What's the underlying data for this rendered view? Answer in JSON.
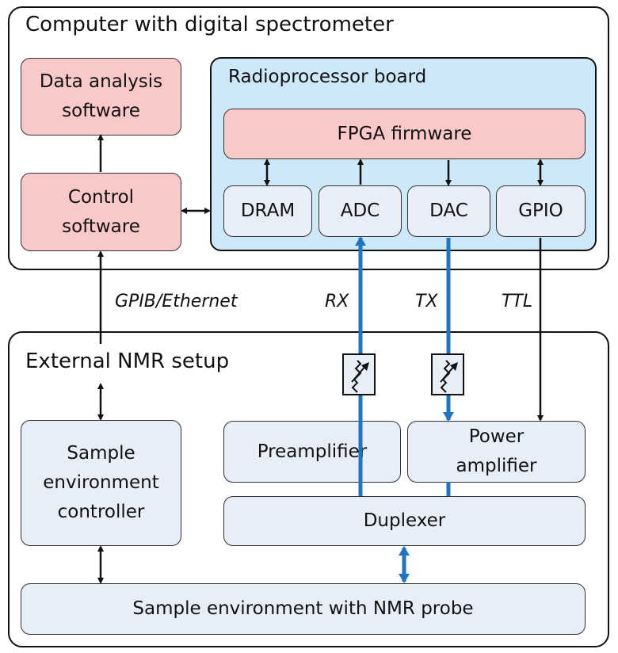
{
  "computer": {
    "title": "Computer with digital spectrometer",
    "data_analysis": "Data analysis software",
    "control": "Control software",
    "board": {
      "title": "Radioprocessor board",
      "fpga": "FPGA firmware",
      "dram": "DRAM",
      "adc": "ADC",
      "dac": "DAC",
      "gpio": "GPIO"
    }
  },
  "links": {
    "gpib": "GPIB/Ethernet",
    "rx": "RX",
    "tx": "TX",
    "ttl": "TTL"
  },
  "external": {
    "title": "External NMR setup",
    "controller": "Sample environment controller",
    "preamp": "Preamplifier",
    "power_amp": "Power amplifier",
    "duplexer": "Duplexer",
    "sample_env": "Sample environment with NMR probe"
  },
  "colors": {
    "software": "#f9c9c9",
    "board": "#cde8f8",
    "hardware": "#e8eef8",
    "rf_signal": "#1f75c0"
  }
}
